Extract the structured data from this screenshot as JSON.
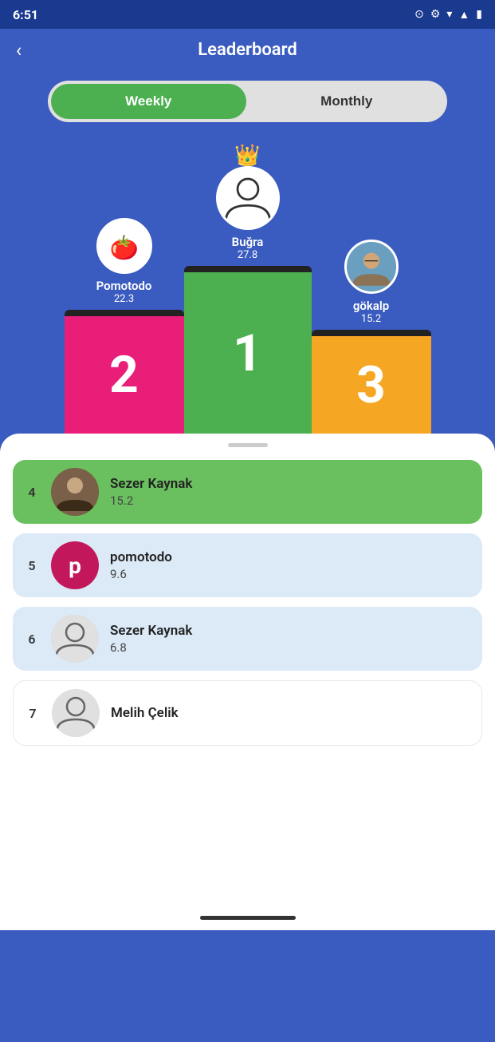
{
  "statusBar": {
    "time": "6:51",
    "icons": [
      "spotify",
      "settings",
      "wifi",
      "signal",
      "battery"
    ]
  },
  "header": {
    "title": "Leaderboard",
    "backLabel": "‹"
  },
  "toggle": {
    "weeklyLabel": "Weekly",
    "monthlyLabel": "Monthly",
    "activeTab": "weekly"
  },
  "podium": {
    "first": {
      "name": "Buğra",
      "score": "27.8",
      "rank": "1",
      "hasPhoto": false
    },
    "second": {
      "name": "Pomotodo",
      "score": "22.3",
      "rank": "2",
      "hasPhoto": false,
      "isPomotodo": true
    },
    "third": {
      "name": "gökalp",
      "score": "15.2",
      "rank": "3",
      "hasPhoto": true
    }
  },
  "leaderboard": [
    {
      "rank": "4",
      "name": "Sezer Kaynak",
      "score": "15.2",
      "type": "photo",
      "highlighted": true
    },
    {
      "rank": "5",
      "name": "pomotodo",
      "score": "9.6",
      "type": "letter",
      "letter": "p",
      "highlighted": false
    },
    {
      "rank": "6",
      "name": "Sezer Kaynak",
      "score": "6.8",
      "type": "person",
      "highlighted": false
    },
    {
      "rank": "7",
      "name": "Melih Çelik",
      "score": "",
      "type": "person",
      "highlighted": false
    }
  ]
}
